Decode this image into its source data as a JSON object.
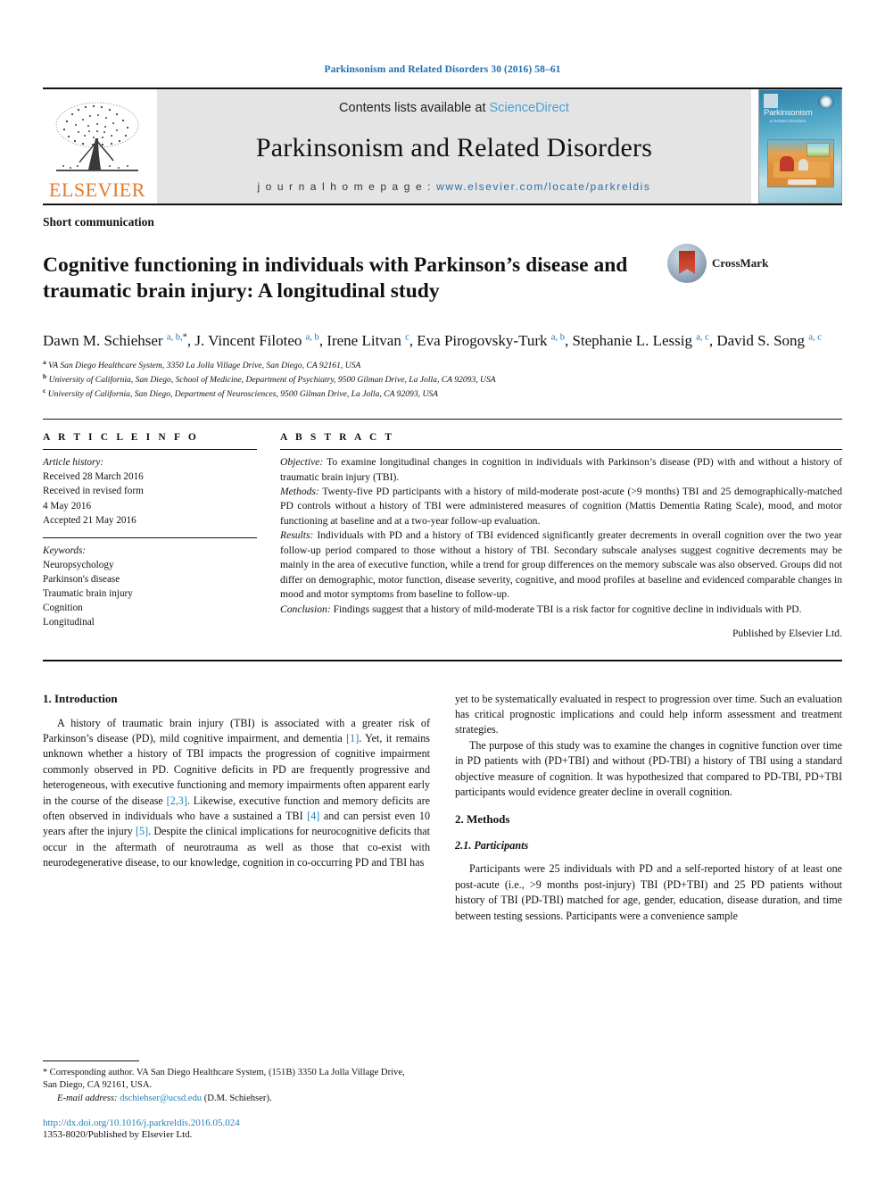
{
  "running_head": "Parkinsonism and Related Disorders 30 (2016) 58–61",
  "masthead": {
    "publisher_name": "ELSEVIER",
    "contents_prefix": "Contents lists available at ",
    "contents_link": "ScienceDirect",
    "journal_title": "Parkinsonism and Related Disorders",
    "homepage_prefix": "j o u r n a l   h o m e p a g e :   ",
    "homepage_url": "www.elsevier.com/locate/parkreldis",
    "cover_title": "Parkinsonism",
    "cover_subtitle": "& Related Disorders"
  },
  "article": {
    "doctype": "Short communication",
    "title": "Cognitive functioning in individuals with Parkinson’s disease and traumatic brain injury: A longitudinal study",
    "crossmark_label": "CrossMark",
    "authors_line_1": "Dawn M. Schiehser",
    "authors": [
      {
        "name": "Dawn M. Schiehser",
        "sup": "a, b,",
        "star": true
      },
      {
        "name": "J. Vincent Filoteo",
        "sup": "a, b",
        "star": false
      },
      {
        "name": "Irene Litvan",
        "sup": "c",
        "star": false
      },
      {
        "name": "Eva Pirogovsky-Turk",
        "sup": "a, b",
        "star": false
      },
      {
        "name": "Stephanie L. Lessig",
        "sup": "a, c",
        "star": false
      },
      {
        "name": "David S. Song",
        "sup": "a, c",
        "star": false
      }
    ],
    "affiliations": [
      {
        "mark": "a",
        "text": "VA San Diego Healthcare System, 3350 La Jolla Village Drive, San Diego, CA 92161, USA"
      },
      {
        "mark": "b",
        "text": "University of California, San Diego, School of Medicine, Department of Psychiatry, 9500 Gilman Drive, La Jolla, CA 92093, USA"
      },
      {
        "mark": "c",
        "text": "University of California, San Diego, Department of Neurosciences, 9500 Gilman Drive, La Jolla, CA 92093, USA"
      }
    ]
  },
  "article_info": {
    "heading": "A R T I C L E   I N F O",
    "history_label": "Article history:",
    "history": [
      "Received 28 March 2016",
      "Received in revised form",
      "4 May 2016",
      "Accepted 21 May 2016"
    ],
    "keywords_label": "Keywords:",
    "keywords": [
      "Neuropsychology",
      "Parkinson's disease",
      "Traumatic brain injury",
      "Cognition",
      "Longitudinal"
    ]
  },
  "abstract": {
    "heading": "A B S T R A C T",
    "objective_label": "Objective:",
    "objective_text": " To examine longitudinal changes in cognition in individuals with Parkinson’s disease (PD) with and without a history of traumatic brain injury (TBI).",
    "methods_label": "Methods:",
    "methods_text": " Twenty-five PD participants with a history of mild-moderate post-acute (>9 months) TBI and 25 demographically-matched PD controls without a history of TBI were administered measures of cognition (Mattis Dementia Rating Scale), mood, and motor functioning at baseline and at a two-year follow-up evaluation.",
    "results_label": "Results:",
    "results_text": " Individuals with PD and a history of TBI evidenced significantly greater decrements in overall cognition over the two year follow-up period compared to those without a history of TBI. Secondary subscale analyses suggest cognitive decrements may be mainly in the area of executive function, while a trend for group differences on the memory subscale was also observed. Groups did not differ on demographic, motor function, disease severity, cognitive, and mood profiles at baseline and evidenced comparable changes in mood and motor symptoms from baseline to follow-up.",
    "conclusion_label": "Conclusion:",
    "conclusion_text": " Findings suggest that a history of mild-moderate TBI is a risk factor for cognitive decline in individuals with PD.",
    "published_by": "Published by Elsevier Ltd."
  },
  "body": {
    "intro_heading": "1. Introduction",
    "intro_p1_a": "A history of traumatic brain injury (TBI) is associated with a greater risk of Parkinson’s disease (PD), mild cognitive impairment, and dementia ",
    "intro_p1_ref1": "[1]",
    "intro_p1_b": ". Yet, it remains unknown whether a history of TBI impacts the progression of cognitive impairment commonly observed in PD. Cognitive deficits in PD are frequently progressive and heterogeneous, with executive functioning and memory impairments often apparent early in the course of the disease ",
    "intro_p1_ref2": "[2,3]",
    "intro_p1_c": ". Likewise, executive function and memory deficits are often observed in individuals who have a sustained a TBI ",
    "intro_p1_ref3": "[4]",
    "intro_p1_d": " and can persist even 10 years after the injury ",
    "intro_p1_ref4": "[5]",
    "intro_p1_e": ". Despite the clinical implications for neurocognitive deficits that occur in the aftermath of neurotrauma as well as those that co-exist with neurodegenerative disease, to our knowledge, cognition in co-occurring PD and TBI has",
    "intro_p1_cont": "yet to be systematically evaluated in respect to progression over time. Such an evaluation has critical prognostic implications and could help inform assessment and treatment strategies.",
    "intro_p2": "The purpose of this study was to examine the changes in cognitive function over time in PD patients with (PD+TBI) and without (PD-TBI) a history of TBI using a standard objective measure of cognition. It was hypothesized that compared to PD-TBI, PD+TBI participants would evidence greater decline in overall cognition.",
    "methods_heading": "2. Methods",
    "participants_heading": "2.1. Participants",
    "participants_p1": "Participants were 25 individuals with PD and a self-reported history of at least one post-acute (i.e., >9 months post-injury) TBI (PD+TBI) and 25 PD patients without history of TBI (PD-TBI) matched for age, gender, education, disease duration, and time between testing sessions. Participants were a convenience sample"
  },
  "footer": {
    "corresponding_star": "*",
    "corresponding_text": " Corresponding author. VA San Diego Healthcare System, (151B) 3350 La Jolla Village Drive, San Diego, CA 92161, USA.",
    "email_label": "E-mail address:",
    "email": "dschiehser@ucsd.edu",
    "email_owner": " (D.M. Schiehser).",
    "doi": "http://dx.doi.org/10.1016/j.parkreldis.2016.05.024",
    "issn": "1353-8020/Published by Elsevier Ltd."
  },
  "colors": {
    "link_blue": "#1f7fb5",
    "sciencedirect_blue": "#4a9fd5",
    "elsevier_orange": "#e87722",
    "band_gray": "#e4e4e4"
  }
}
